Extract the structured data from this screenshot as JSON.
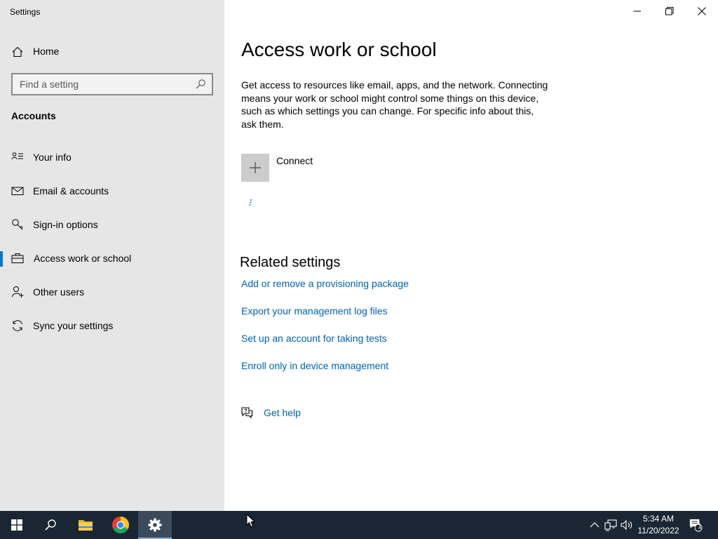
{
  "window": {
    "app_title": "Settings",
    "controls": [
      "minimize-icon",
      "restore-icon",
      "close-icon"
    ]
  },
  "nav": {
    "home_label": "Home",
    "search_placeholder": "Find a setting",
    "section_title": "Accounts",
    "items": [
      {
        "label": "Your info",
        "icon": "person-card-icon",
        "selected": false
      },
      {
        "label": "Email & accounts",
        "icon": "mail-icon",
        "selected": false
      },
      {
        "label": "Sign-in options",
        "icon": "key-icon",
        "selected": false
      },
      {
        "label": "Access work or school",
        "icon": "briefcase-icon",
        "selected": true
      },
      {
        "label": "Other users",
        "icon": "person-add-icon",
        "selected": false
      },
      {
        "label": "Sync your settings",
        "icon": "sync-icon",
        "selected": false
      }
    ]
  },
  "main": {
    "title": "Access work or school",
    "description": "Get access to resources like email, apps, and the network. Connecting means your work or school might control some things on this device, such as which settings you can change. For specific info about this, ask them.",
    "connect_label": "Connect",
    "related_title": "Related settings",
    "related_links": [
      "Add or remove a provisioning package",
      "Export your management log files",
      "Set up an account for taking tests",
      "Enroll only in device management"
    ],
    "help_label": "Get help"
  },
  "taskbar": {
    "apps": [
      "windows-start-icon",
      "search-icon",
      "file-explorer-icon",
      "chrome-icon",
      "settings-gear-icon"
    ],
    "active_app": "settings-gear-icon",
    "time": "5:34 AM",
    "date": "11/20/2022",
    "notification_count": "1"
  },
  "colors": {
    "nav_bg": "#e6e6e6",
    "accent": "#0078d7",
    "link": "#0063b1",
    "taskbar_bg": "#1a2633"
  }
}
